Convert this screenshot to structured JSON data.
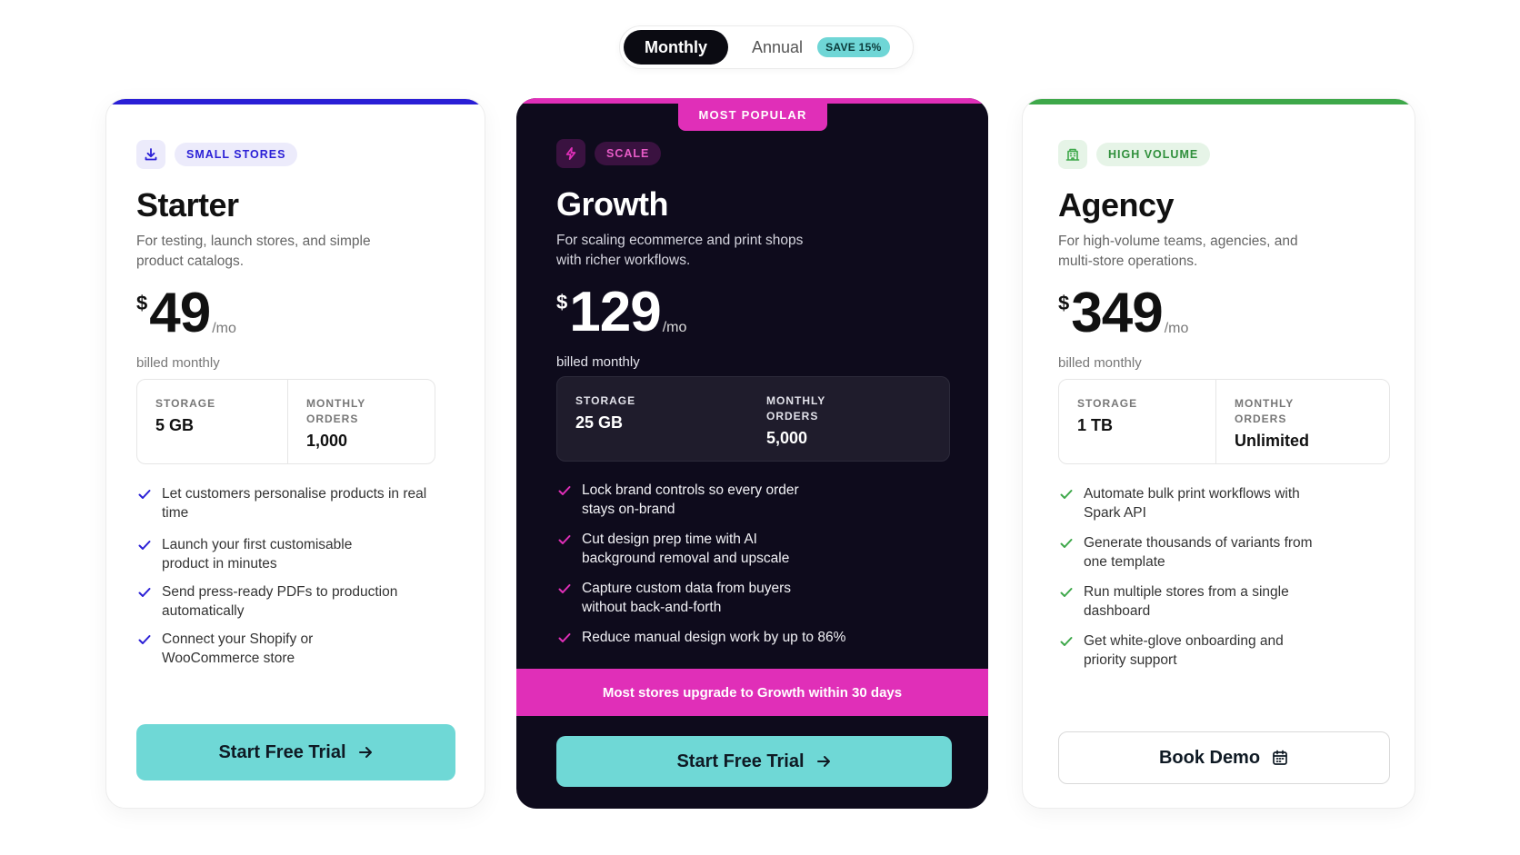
{
  "billing_toggle": {
    "monthly_label": "Monthly",
    "annual_label": "Annual",
    "save_badge": "SAVE 15%"
  },
  "plans": [
    {
      "tag": "SMALL STORES",
      "icon": "download-icon",
      "name": "Starter",
      "description": "For testing, launch stores, and simple product catalogs.",
      "currency": "$",
      "price": "49",
      "period": "/mo",
      "billed": "billed monthly",
      "stats": [
        {
          "label": "STORAGE",
          "value": "5 GB"
        },
        {
          "label": "MONTHLY ORDERS",
          "value": "1,000"
        }
      ],
      "features": [
        "Let customers personalise products in real time",
        "Launch your first customisable product in minutes",
        "Send press-ready PDFs to production automatically",
        "Connect your Shopify or WooCommerce store"
      ],
      "cta": "Start Free Trial",
      "accent": "#2a1fd6"
    },
    {
      "badge": "MOST POPULAR",
      "tag": "SCALE",
      "icon": "lightning-icon",
      "name": "Growth",
      "description": "For scaling ecommerce and print shops with richer workflows.",
      "currency": "$",
      "price": "129",
      "period": "/mo",
      "billed": "billed monthly",
      "stats": [
        {
          "label": "STORAGE",
          "value": "25 GB"
        },
        {
          "label": "MONTHLY ORDERS",
          "value": "5,000"
        }
      ],
      "features": [
        "Lock brand controls so every order stays on-brand",
        "Cut design prep time with AI background removal and upscale",
        "Capture custom data from buyers without back-and-forth",
        "Reduce manual design work by up to 86%"
      ],
      "banner": "Most stores upgrade to Growth within 30 days",
      "cta": "Start Free Trial",
      "accent": "#e02fb8"
    },
    {
      "tag": "HIGH VOLUME",
      "icon": "building-icon",
      "name": "Agency",
      "description": "For high-volume teams, agencies, and multi-store operations.",
      "currency": "$",
      "price": "349",
      "period": "/mo",
      "billed": "billed monthly",
      "stats": [
        {
          "label": "STORAGE",
          "value": "1 TB"
        },
        {
          "label": "MONTHLY ORDERS",
          "value": "Unlimited"
        }
      ],
      "features": [
        "Automate bulk print workflows with Spark API",
        "Generate thousands of variants from one template",
        "Run multiple stores from a single dashboard",
        "Get white-glove onboarding and priority support"
      ],
      "cta": "Book Demo",
      "cta_icon": "calendar-icon",
      "accent": "#3ea84a"
    }
  ]
}
